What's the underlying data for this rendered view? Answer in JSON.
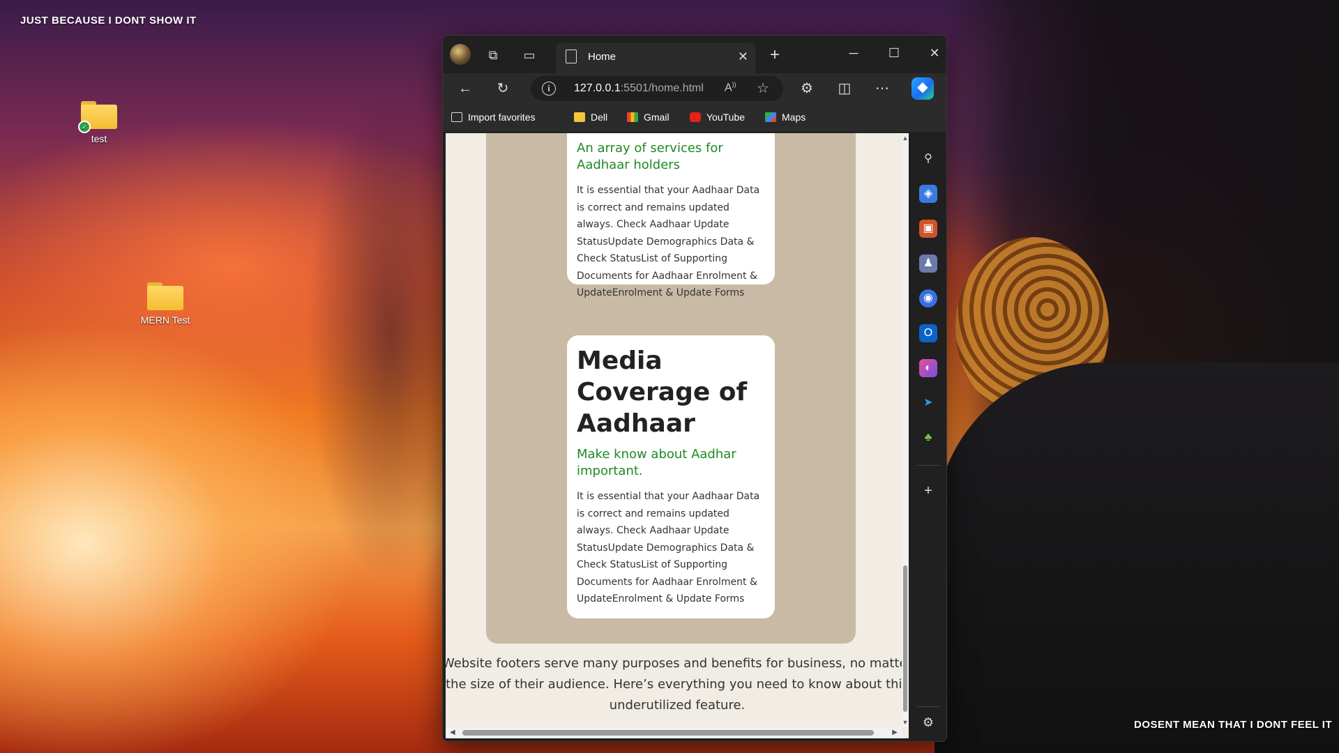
{
  "wallpaper": {
    "top_text": "JUST BECAUSE I DONT SHOW IT",
    "bottom_text": "DOSENT MEAN THAT I DONT FEEL IT"
  },
  "desktop_icons": [
    {
      "label": "test"
    },
    {
      "label": "MERN Test"
    }
  ],
  "browser": {
    "tab": {
      "title": "Home"
    },
    "address": {
      "host": "127.0.0.1",
      "rest": ":5501/home.html"
    },
    "bookmarks": [
      {
        "label": "Import favorites",
        "icon": "import-icon"
      },
      {
        "label": "Dell",
        "icon": "folder-icon"
      },
      {
        "label": "Gmail",
        "icon": "gmail-icon"
      },
      {
        "label": "YouTube",
        "icon": "youtube-icon"
      },
      {
        "label": "Maps",
        "icon": "maps-icon"
      }
    ],
    "sidebar_icons": [
      "search-icon",
      "tag-icon",
      "toolbox-icon",
      "games-icon",
      "copilot-icon",
      "outlook-icon",
      "designer-icon",
      "send-icon",
      "tree-icon",
      "add-icon",
      "settings-icon"
    ]
  },
  "page": {
    "card1": {
      "subtitle": "An array of services for Aadhaar holders",
      "text": "It is essential that your Aadhaar Data is correct and remains updated always. Check Aadhaar Update StatusUpdate Demographics Data & Check StatusList of Supporting Documents for Aadhaar Enrolment & UpdateEnrolment & Update Forms"
    },
    "card2": {
      "title": "Media Coverage of Aadhaar",
      "subtitle": "Make know about Aadhar important.",
      "text": "It is essential that your Aadhaar Data is correct and remains updated always. Check Aadhaar Update StatusUpdate Demographics Data & Check StatusList of Supporting Documents for Aadhaar Enrolment & UpdateEnrolment & Update Forms"
    },
    "footer": {
      "line1": "Website footers serve many purposes and benefits for business, no matter",
      "line2": "the size of their audience. Here’s everything you need to know about this",
      "line3": "underutilized feature."
    }
  },
  "colors": {
    "accent_green": "#1e8a22",
    "panel": "#c9baa6",
    "page_bg": "#f1ece4"
  }
}
